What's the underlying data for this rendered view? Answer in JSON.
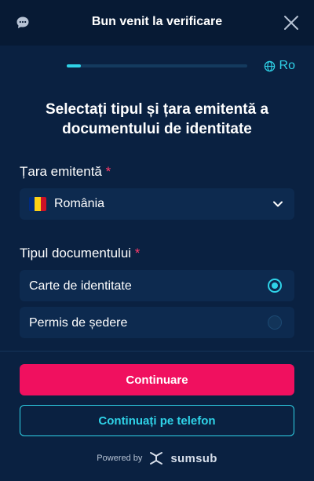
{
  "header": {
    "title": "Bun venit la verificare",
    "chat_icon": "chat-bubble-icon",
    "close_icon": "close-icon"
  },
  "progress": {
    "value": 0.08
  },
  "language": {
    "label": "Ro",
    "icon": "globe-icon"
  },
  "heading": "Selectați tipul și țara emitentă a documentului de identitate",
  "country": {
    "label": "Țara emitentă",
    "required_mark": "*",
    "selected": "România",
    "flag_colors": [
      "#002b7f",
      "#fcd116",
      "#ce1126"
    ],
    "icon": "chevron-down-icon"
  },
  "document_type": {
    "label": "Tipul documentului",
    "required_mark": "*",
    "options": [
      {
        "label": "Carte de identitate",
        "selected": true
      },
      {
        "label": "Permis de ședere",
        "selected": false
      }
    ]
  },
  "actions": {
    "continue_label": "Continuare",
    "phone_label": "Continuați pe telefon"
  },
  "footer": {
    "powered_by": "Powered by",
    "brand": "sumsub",
    "brand_icon": "sumsub-logo-icon"
  },
  "colors": {
    "background": "#0a2141",
    "accent": "#2fd3e8",
    "primary_button": "#f0105f",
    "required": "#ff3b6b"
  }
}
